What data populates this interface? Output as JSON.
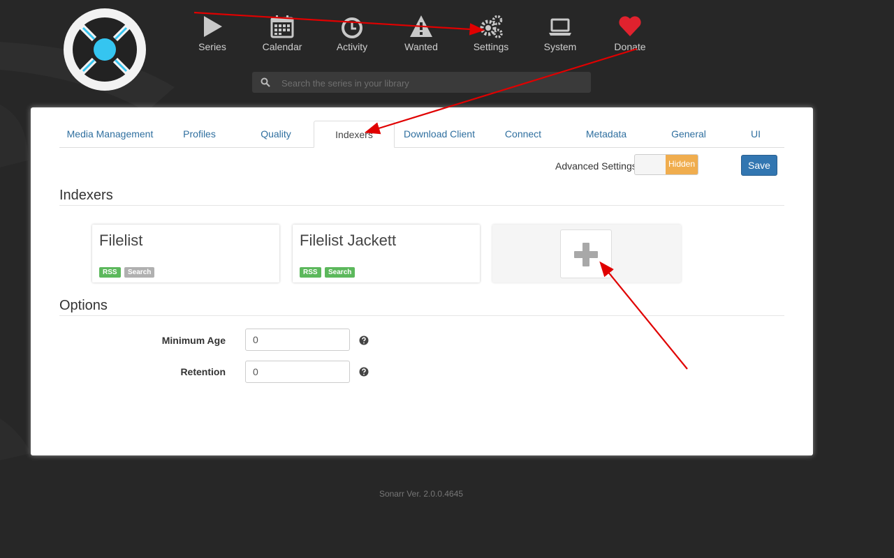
{
  "nav": {
    "items": [
      {
        "label": "Series",
        "icon": "play-icon"
      },
      {
        "label": "Calendar",
        "icon": "calendar-icon"
      },
      {
        "label": "Activity",
        "icon": "clock-icon"
      },
      {
        "label": "Wanted",
        "icon": "warning-icon"
      },
      {
        "label": "Settings",
        "icon": "gears-icon"
      },
      {
        "label": "System",
        "icon": "laptop-icon"
      },
      {
        "label": "Donate",
        "icon": "heart-icon"
      }
    ]
  },
  "search": {
    "placeholder": "Search the series in your library"
  },
  "tabs": [
    {
      "label": "Media Management"
    },
    {
      "label": "Profiles"
    },
    {
      "label": "Quality"
    },
    {
      "label": "Indexers",
      "active": true
    },
    {
      "label": "Download Client"
    },
    {
      "label": "Connect"
    },
    {
      "label": "Metadata"
    },
    {
      "label": "General"
    },
    {
      "label": "UI"
    }
  ],
  "toolbar": {
    "advanced_label": "Advanced Settings",
    "advanced_state": "Hidden",
    "save_label": "Save"
  },
  "indexers": {
    "title": "Indexers",
    "items": [
      {
        "name": "Filelist",
        "badges": [
          {
            "label": "RSS",
            "enabled": true
          },
          {
            "label": "Search",
            "enabled": false
          }
        ]
      },
      {
        "name": "Filelist Jackett",
        "badges": [
          {
            "label": "RSS",
            "enabled": true
          },
          {
            "label": "Search",
            "enabled": true
          }
        ]
      }
    ]
  },
  "options": {
    "title": "Options",
    "minimum_age": {
      "label": "Minimum Age",
      "value": "0"
    },
    "retention": {
      "label": "Retention",
      "value": "0"
    }
  },
  "footer": {
    "version": "Sonarr Ver. 2.0.0.4645"
  },
  "colors": {
    "accent_blue": "#3276b1",
    "badge_green": "#5cb85c",
    "badge_gray": "#b0b0b0",
    "toggle_orange": "#f0ad4e",
    "heart_red": "#e0222e",
    "logo_blue": "#35c5f0",
    "annotation_red": "#e00000"
  }
}
